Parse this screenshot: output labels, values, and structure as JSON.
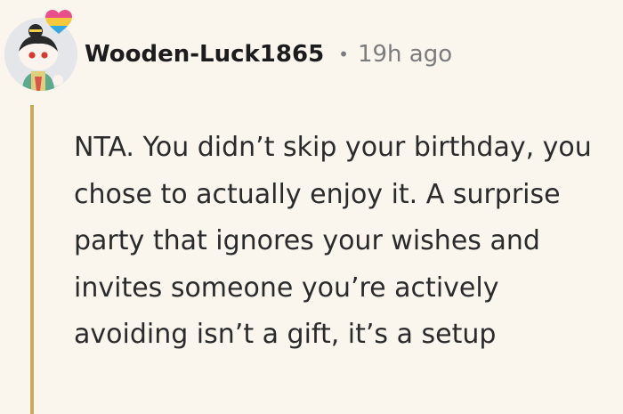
{
  "comment": {
    "username": "Wooden-Luck1865",
    "separator": "•",
    "timestamp": "19h ago",
    "body": "NTA. You didn’t skip your birthday, you chose to actually enjoy it. A surprise party that ignores your wishes and invites someone you’re actively avoiding isn’t a gift, it’s a setup"
  },
  "avatar": {
    "icon": "snoo-avatar-icon",
    "flair_icon": "pride-heart-icon",
    "flair_colors": [
      "#e94f8a",
      "#f5c93b",
      "#34a8e0"
    ]
  },
  "colors": {
    "background": "#faf6ee",
    "thread_line": "#c7ab59",
    "meta_text": "#7c7c7c"
  }
}
